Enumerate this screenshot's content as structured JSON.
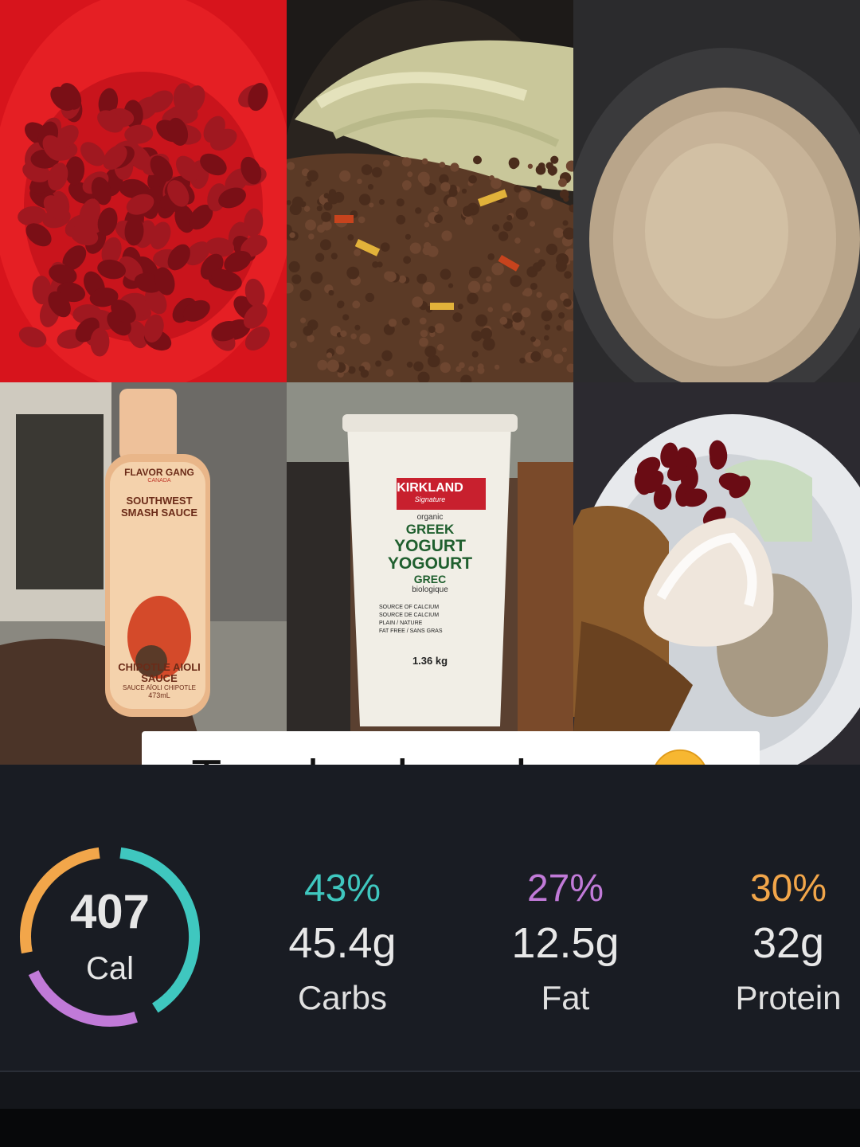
{
  "caption": {
    "text": "Taco bowl meal prep",
    "emoji": "face-savoring-food"
  },
  "photos": [
    {
      "name": "kidney-beans"
    },
    {
      "name": "ground-beef-cabbage"
    },
    {
      "name": "brown-rice"
    },
    {
      "name": "sauce-bottle",
      "brand": "FLAVOR GANG",
      "brand_sub": "CANADA",
      "title": "SOUTHWEST SMASH SAUCE",
      "product": "CHIPOTLE AIOLI SAUCE",
      "product_fr": "SAUCE AÏOLI CHIPOTLE",
      "volume": "473mL"
    },
    {
      "name": "yogurt-tub",
      "brand": "KIRKLAND",
      "brand_sub": "Signature",
      "organic": "organic",
      "line1": "GREEK",
      "line2": "YOGURT",
      "line3": "YOGOURT",
      "line4": "GREC",
      "organic_fr": "biologique",
      "claim1": "SOURCE OF CALCIUM",
      "claim1_fr": "SOURCE DE CALCIUM",
      "claim2": "PLAIN / NATURE",
      "claim3": "FAT FREE / SANS GRAS",
      "weight": "1.36 kg"
    },
    {
      "name": "taco-bowl"
    }
  ],
  "nutrition": {
    "calories": "407",
    "calories_unit": "Cal",
    "carbs": {
      "pct": "43%",
      "grams": "45.4g",
      "label": "Carbs",
      "color": "#3fc7bf",
      "fraction": 0.43
    },
    "fat": {
      "pct": "27%",
      "grams": "12.5g",
      "label": "Fat",
      "color": "#c17ad8",
      "fraction": 0.27
    },
    "protein": {
      "pct": "30%",
      "grams": "32g",
      "label": "Protein",
      "color": "#f2a64a",
      "fraction": 0.3
    }
  }
}
